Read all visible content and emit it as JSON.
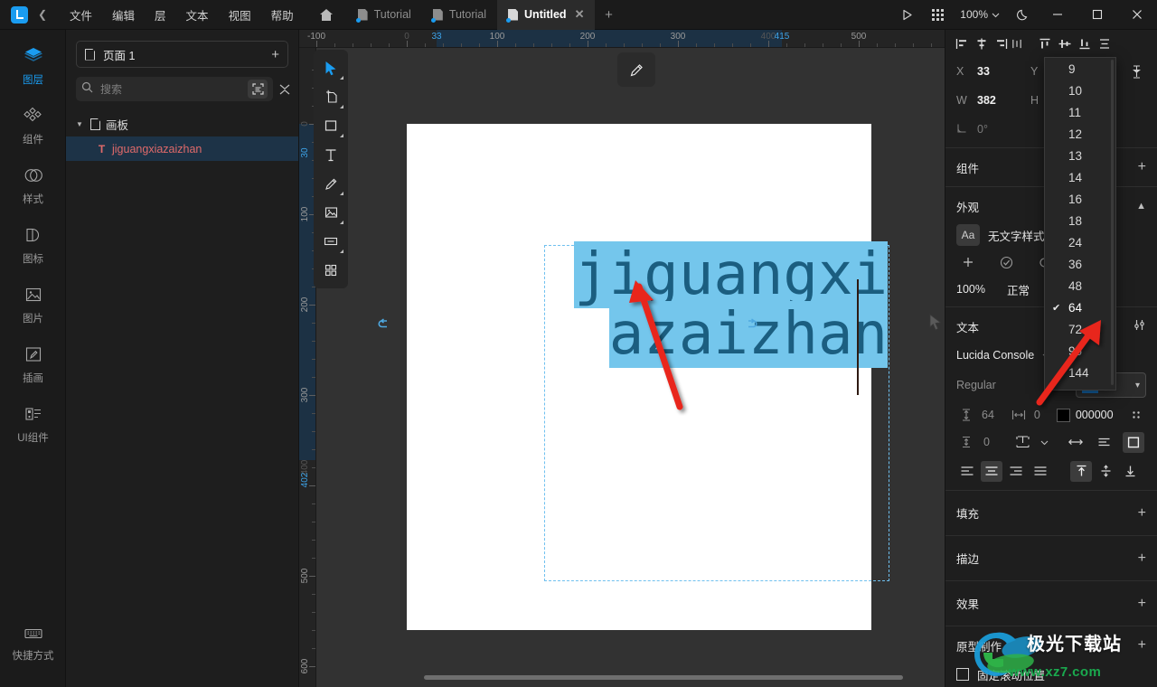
{
  "app": {
    "logo_icon": "app-logo",
    "back_icon": "chevron-left-icon",
    "menus": [
      "文件",
      "编辑",
      "层",
      "文本",
      "视图",
      "帮助"
    ],
    "home_icon": "home-icon"
  },
  "tabs": [
    {
      "label": "Tutorial",
      "active": false,
      "closable": false
    },
    {
      "label": "Tutorial",
      "active": false,
      "closable": false
    },
    {
      "label": "Untitled",
      "active": true,
      "closable": true
    }
  ],
  "tab_add_label": "+",
  "titlebar_right": {
    "play_icon": "play-icon",
    "grid_icon": "apps-grid-icon",
    "zoom_level": "100%",
    "zoom_caret": "chevron-down-icon",
    "theme_icon": "moon-icon",
    "minimize": "—",
    "maximize": "□",
    "close": "✕"
  },
  "rail": {
    "items": [
      {
        "label": "图层",
        "icon": "layers-icon",
        "active": true
      },
      {
        "label": "组件",
        "icon": "components-icon",
        "active": false
      },
      {
        "label": "样式",
        "icon": "styles-icon",
        "active": false
      },
      {
        "label": "图标",
        "icon": "icons-icon",
        "active": false
      },
      {
        "label": "图片",
        "icon": "image-icon",
        "active": false
      },
      {
        "label": "插画",
        "icon": "illustration-icon",
        "active": false
      },
      {
        "label": "UI组件",
        "icon": "ui-kit-icon",
        "active": false
      }
    ],
    "bottom": {
      "label": "快捷方式",
      "icon": "keyboard-icon"
    }
  },
  "layers_panel": {
    "page": {
      "label": "页面 1",
      "icon": "page-icon",
      "add_label": "+"
    },
    "search": {
      "placeholder": "搜索",
      "value": "",
      "icon": "search-icon",
      "scan_icon": "select-area-icon",
      "collapse_icon": "collapse-all-icon"
    },
    "tree": [
      {
        "label": "画板",
        "type": "artboard",
        "depth": 0,
        "selected": false,
        "expanded": true
      },
      {
        "label": "jiguangxiazaizhan",
        "type": "text",
        "depth": 1,
        "selected": true,
        "glyph": "T"
      }
    ]
  },
  "canvas": {
    "artboard": {
      "name": "画板",
      "size": "514×560"
    },
    "text_layer": {
      "line1": "jiguangxi",
      "line2": "azaizhan",
      "font": "DejaVu Sans Mono",
      "color": "#1b5e80",
      "selection_color": "#74c6ec"
    },
    "pen_button_icon": "pencil-icon",
    "tools": [
      {
        "icon": "cursor-select-icon",
        "active": true,
        "has_corner": true
      },
      {
        "icon": "frame-icon",
        "active": false,
        "has_corner": true
      },
      {
        "icon": "rectangle-icon",
        "active": false,
        "has_corner": true
      },
      {
        "icon": "text-tool-icon",
        "active": false,
        "has_corner": false
      },
      {
        "icon": "pen-tool-icon",
        "active": false,
        "has_corner": true
      },
      {
        "icon": "image-tool-icon",
        "active": false,
        "has_corner": true
      },
      {
        "icon": "component-tool-icon",
        "active": false,
        "has_corner": true
      },
      {
        "icon": "more-tools-icon",
        "active": false,
        "has_corner": false
      }
    ],
    "ruler_h": [
      {
        "text": "-100",
        "pos": -100,
        "style": "normal"
      },
      {
        "text": "0",
        "pos": 0,
        "style": "dim"
      },
      {
        "text": "33",
        "pos": 33,
        "style": "active"
      },
      {
        "text": "100",
        "pos": 100,
        "style": "normal"
      },
      {
        "text": "200",
        "pos": 200,
        "style": "normal"
      },
      {
        "text": "300",
        "pos": 300,
        "style": "normal"
      },
      {
        "text": "400",
        "pos": 400,
        "style": "dim"
      },
      {
        "text": "415",
        "pos": 415,
        "style": "active"
      },
      {
        "text": "500",
        "pos": 500,
        "style": "normal"
      }
    ],
    "ruler_v": [
      {
        "text": "0",
        "pos": 0,
        "style": "dim"
      },
      {
        "text": "30",
        "pos": 30,
        "style": "active"
      },
      {
        "text": "100",
        "pos": 100,
        "style": "normal"
      },
      {
        "text": "200",
        "pos": 200,
        "style": "normal"
      },
      {
        "text": "300",
        "pos": 300,
        "style": "normal"
      },
      {
        "text": "400",
        "pos": 400,
        "style": "dim"
      },
      {
        "text": "402",
        "pos": 402,
        "style": "active"
      },
      {
        "text": "500",
        "pos": 500,
        "style": "normal"
      },
      {
        "text": "600",
        "pos": 600,
        "style": "normal"
      }
    ]
  },
  "right_panel": {
    "align_icons": [
      "align-left-icon",
      "align-horizontal-center-icon",
      "align-right-icon",
      "distribute-horizontal-icon",
      "align-top-icon",
      "align-vertical-center-icon",
      "align-bottom-icon",
      "distribute-vertical-icon"
    ],
    "transform": {
      "x_label": "X",
      "x_value": "33",
      "y_label": "Y",
      "y_value": "",
      "w_label": "W",
      "w_value": "382",
      "h_label": "H",
      "h_value": "",
      "rotation_label": "0°",
      "rotation_icon": "rotation-icon",
      "constrain_icon": "constrain-proportions-icon"
    },
    "sections": {
      "components": {
        "title": "组件",
        "action": "+"
      },
      "appearance": {
        "title": "外观",
        "collapse_icon": "chevron-up-icon",
        "text_style": "无文字样式",
        "text_style_icon": "Aa",
        "add_icon": "plus-icon",
        "check_icon": "check-circle-icon",
        "reset_icon": "reset-icon",
        "opacity": "100%",
        "blend_mode": "正常"
      },
      "text": {
        "title": "文本",
        "settings_icon": "text-settings-icon",
        "font_family": "Lucida Console",
        "font_weight": "Regular",
        "font_size": "64",
        "line_height_icon": "line-height-icon",
        "line_height": "64",
        "letter_spacing_icon": "letter-spacing-icon",
        "letter_spacing": "0",
        "color_hex": "000000",
        "color_swatch": "#000000",
        "more_icon": "more-options-icon",
        "paragraph_spacing_icon": "paragraph-spacing-icon",
        "paragraph_spacing": "0",
        "resize_icon": "text-resize-icon",
        "resize_caret": "chevron-down-icon",
        "auto_width_icon": "auto-width-icon",
        "auto_height_icon": "auto-height-icon",
        "fixed_size_icon": "fixed-size-icon",
        "align_icons": [
          "text-align-left-icon",
          "text-align-center-icon",
          "text-align-right-icon",
          "text-align-justify-icon"
        ],
        "valign_icons": [
          "text-valign-top-icon",
          "text-valign-middle-icon",
          "text-valign-bottom-icon"
        ],
        "align_active_index": 1,
        "valign_active_index": 0,
        "vertical_resize_active": 2
      },
      "fill": {
        "title": "填充",
        "action": "+"
      },
      "stroke": {
        "title": "描边",
        "action": "+"
      },
      "effect": {
        "title": "效果",
        "action": "+"
      },
      "prototype": {
        "title": "原型制作",
        "action": "+",
        "checkbox_label": "固定滚动位置",
        "checked": false
      }
    }
  },
  "font_size_dropdown": {
    "options": [
      "9",
      "10",
      "11",
      "12",
      "13",
      "14",
      "16",
      "18",
      "24",
      "36",
      "48",
      "64",
      "72",
      "96",
      "144"
    ],
    "selected": "64",
    "check_glyph": "✔"
  },
  "watermark": {
    "cn": "极光下载站",
    "url": "www.xz7.com"
  },
  "colors": {
    "accent": "#1a9cf0",
    "selection_blue": "#74c6ec",
    "text_blue": "#1b5e80",
    "annotation_red": "#e8251f",
    "panel_bg": "#1e1e1e",
    "canvas_bg": "#323232"
  }
}
